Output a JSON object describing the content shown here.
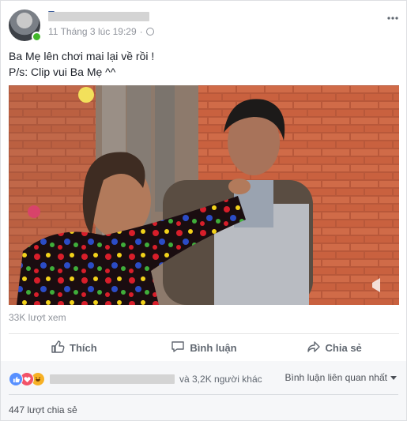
{
  "post": {
    "author_prefix": "T",
    "timestamp": "11 Tháng 3 lúc 19:29",
    "privacy_icon": "globe-icon",
    "menu_icon": "more-icon",
    "text_lines": [
      "Ba Mẹ lên chơi mai lại về rồi !",
      "P/s: Clip vui Ba Mẹ ^^"
    ],
    "views": "33K lượt xem"
  },
  "actions": {
    "like": "Thích",
    "comment": "Bình luận",
    "share": "Chia sẻ"
  },
  "footer": {
    "reactions_suffix": "và 3,2K người khác",
    "sort_label": "Bình luận liên quan nhất",
    "shares": "447 lượt chia sẻ"
  },
  "colors": {
    "accent": "#365899",
    "online": "#42b72a",
    "like": "#5890ff",
    "love": "#f25268",
    "haha": "#f7b125"
  }
}
